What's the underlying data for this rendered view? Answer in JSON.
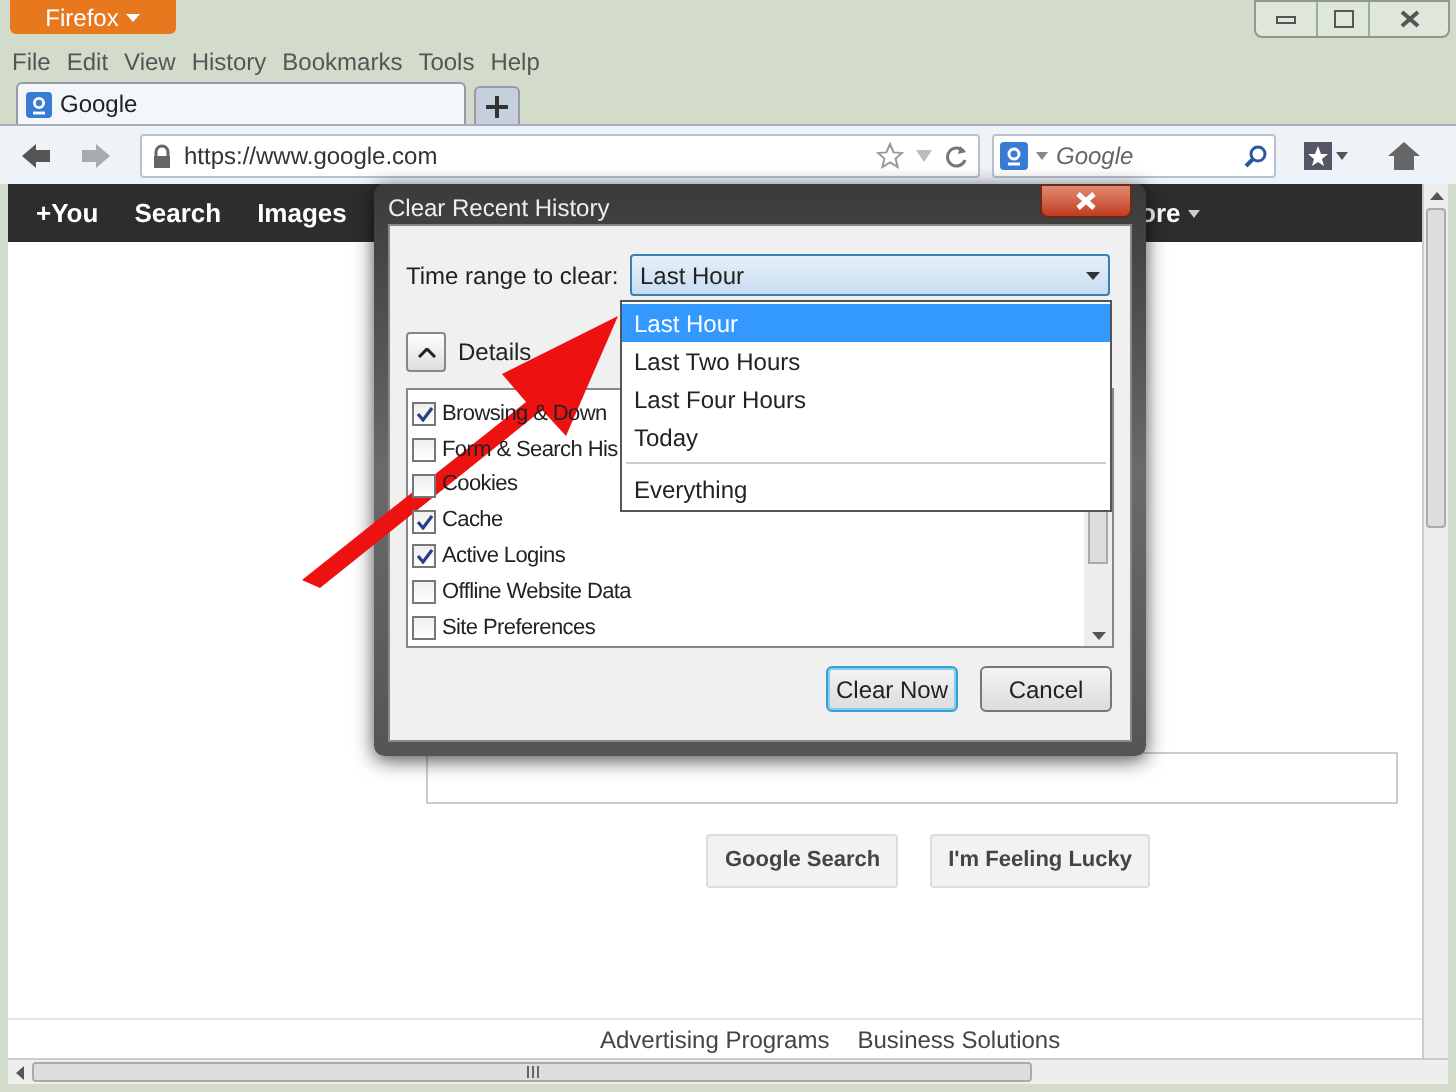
{
  "browser": {
    "app_button": "Firefox",
    "menu": [
      "File",
      "Edit",
      "View",
      "History",
      "Bookmarks",
      "Tools",
      "Help"
    ],
    "tabs": [
      {
        "label": "Google",
        "selected": true
      }
    ],
    "address": "https://www.google.com",
    "search_placeholder": "Google"
  },
  "page": {
    "nav": [
      "+You",
      "Search",
      "Images",
      "ore"
    ],
    "buttons": [
      "Google Search",
      "I'm Feeling Lucky"
    ],
    "footer": [
      "Advertising Programs",
      "Business Solutions"
    ]
  },
  "dialog": {
    "title": "Clear Recent History",
    "time_range_label": "Time range to clear:",
    "time_range_value": "Last Hour",
    "options": [
      {
        "label": "Last Hour",
        "selected": true
      },
      {
        "label": "Last Two Hours",
        "selected": false
      },
      {
        "label": "Last Four Hours",
        "selected": false
      },
      {
        "label": "Today",
        "selected": false
      },
      {
        "label": "Everything",
        "selected": false
      }
    ],
    "details_label": "Details",
    "items": [
      {
        "label": "Browsing & Down",
        "checked": true
      },
      {
        "label": "Form & Search His",
        "checked": false
      },
      {
        "label": "Cookies",
        "checked": false
      },
      {
        "label": "Cache",
        "checked": true
      },
      {
        "label": "Active Logins",
        "checked": true
      },
      {
        "label": "Offline Website Data",
        "checked": false
      },
      {
        "label": "Site Preferences",
        "checked": false
      }
    ],
    "buttons": [
      {
        "label": "Clear Now",
        "kind": "default"
      },
      {
        "label": "Cancel",
        "kind": "normal"
      }
    ]
  }
}
